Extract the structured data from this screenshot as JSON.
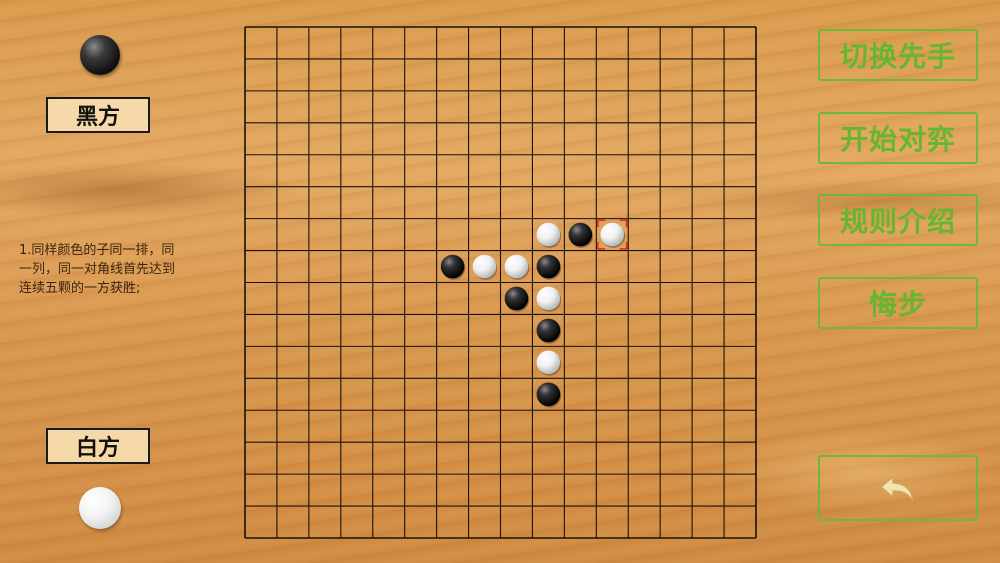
{
  "players": {
    "black_label": "黑方",
    "white_label": "白方"
  },
  "rules_text": "1.同样颜色的子同一排，同一列，同一对角线首先达到连续五颗的一方获胜;",
  "menu": {
    "switch_first": "切换先手",
    "start_game": "开始对弈",
    "rules_intro": "规则介绍",
    "undo": "悔步",
    "back_icon": "undo-arrow-icon"
  },
  "board": {
    "lines": 16,
    "stones": [
      {
        "col": 9,
        "row": 6,
        "color": "white"
      },
      {
        "col": 10,
        "row": 6,
        "color": "black"
      },
      {
        "col": 11,
        "row": 6,
        "color": "white",
        "last_move": true
      },
      {
        "col": 6,
        "row": 7,
        "color": "black"
      },
      {
        "col": 7,
        "row": 7,
        "color": "white"
      },
      {
        "col": 8,
        "row": 7,
        "color": "white"
      },
      {
        "col": 9,
        "row": 7,
        "color": "black"
      },
      {
        "col": 8,
        "row": 8,
        "color": "black"
      },
      {
        "col": 9,
        "row": 8,
        "color": "white"
      },
      {
        "col": 9,
        "row": 9,
        "color": "black"
      },
      {
        "col": 9,
        "row": 10,
        "color": "white"
      },
      {
        "col": 9,
        "row": 11,
        "color": "black"
      }
    ]
  },
  "colors": {
    "button_green": "#66b630",
    "last_move_marker": "#e0301e"
  }
}
